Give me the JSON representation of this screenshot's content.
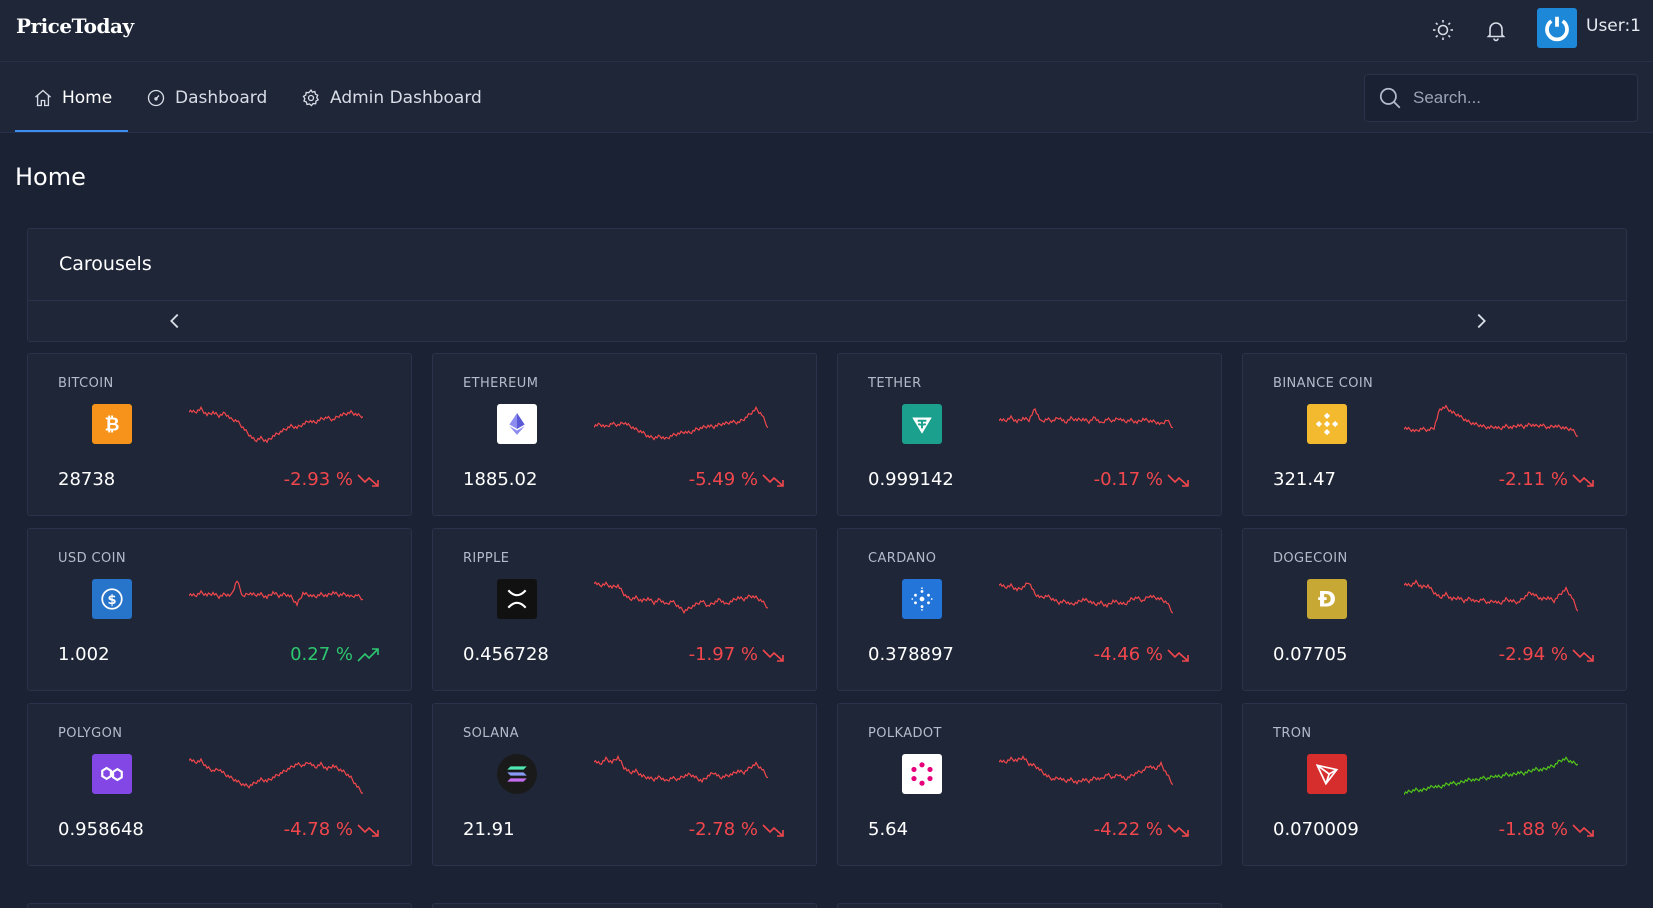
{
  "app": {
    "logo": "PriceToday"
  },
  "topbar": {
    "user_label": "User:1"
  },
  "nav": {
    "items": [
      {
        "label": "Home",
        "icon": "home-icon"
      },
      {
        "label": "Dashboard",
        "icon": "gauge-icon"
      },
      {
        "label": "Admin Dashboard",
        "icon": "gear-icon"
      }
    ],
    "search_placeholder": "Search..."
  },
  "page": {
    "title": "Home"
  },
  "carousel": {
    "title": "Carousels"
  },
  "colors": {
    "down": "#f1474c",
    "up": "#2ec770",
    "accent": "#3b8ff0"
  },
  "coins": [
    {
      "name": "BITCOIN",
      "price": "28738",
      "change": "-2.93 %",
      "direction": "down",
      "icon": "bitcoin-icon",
      "icon_bg": "#f7931a",
      "trend": [
        60,
        58,
        62,
        55,
        58,
        54,
        57,
        50,
        48,
        40,
        32,
        25,
        28,
        24,
        30,
        34,
        38,
        42,
        40,
        44,
        48,
        46,
        50,
        52,
        49,
        54,
        56,
        58,
        55,
        53
      ]
    },
    {
      "name": "ETHEREUM",
      "price": "1885.02",
      "change": "-5.49 %",
      "direction": "down",
      "icon": "ethereum-icon",
      "icon_bg": "#ffffff",
      "trend": [
        42,
        44,
        41,
        45,
        43,
        46,
        42,
        38,
        35,
        30,
        28,
        30,
        27,
        31,
        33,
        35,
        34,
        38,
        40,
        42,
        41,
        44,
        45,
        47,
        46,
        50,
        56,
        62,
        55,
        40
      ]
    },
    {
      "name": "TETHER",
      "price": "0.999142",
      "change": "-0.17 %",
      "direction": "down",
      "icon": "tether-icon",
      "icon_bg": "#1aa08c",
      "trend": [
        50,
        48,
        52,
        47,
        51,
        49,
        62,
        47,
        50,
        48,
        52,
        46,
        51,
        49,
        50,
        47,
        52,
        45,
        50,
        48,
        51,
        47,
        49,
        46,
        50,
        48,
        47,
        44,
        49,
        40
      ]
    },
    {
      "name": "BINANCE COIN",
      "price": "321.47",
      "change": "-2.11 %",
      "direction": "down",
      "icon": "binance-icon",
      "icon_bg": "#f3ba2f",
      "trend": [
        40,
        38,
        36,
        39,
        37,
        40,
        62,
        64,
        58,
        55,
        50,
        46,
        44,
        42,
        40,
        41,
        39,
        42,
        40,
        43,
        41,
        44,
        42,
        43,
        40,
        42,
        41,
        39,
        38,
        30
      ]
    },
    {
      "name": "USD COIN",
      "price": "1.002",
      "change": "0.27 %",
      "direction": "up",
      "icon": "usdc-icon",
      "icon_bg": "#2775ca",
      "trend": [
        50,
        48,
        52,
        49,
        51,
        47,
        50,
        48,
        66,
        47,
        51,
        49,
        50,
        46,
        52,
        48,
        50,
        47,
        38,
        51,
        49,
        47,
        50,
        48,
        52,
        49,
        50,
        47,
        49,
        44
      ]
    },
    {
      "name": "RIPPLE",
      "price": "0.456728",
      "change": "-1.97 %",
      "direction": "down",
      "icon": "ripple-icon",
      "icon_bg": "#111111",
      "trend": [
        64,
        60,
        62,
        58,
        60,
        50,
        44,
        46,
        42,
        45,
        40,
        44,
        38,
        42,
        36,
        30,
        34,
        38,
        42,
        36,
        40,
        44,
        38,
        42,
        46,
        44,
        48,
        46,
        42,
        34
      ]
    },
    {
      "name": "CARDANO",
      "price": "0.378897",
      "change": "-4.46 %",
      "direction": "down",
      "icon": "cardano-icon",
      "icon_bg": "#2375da",
      "trend": [
        62,
        58,
        60,
        55,
        58,
        64,
        50,
        46,
        48,
        44,
        40,
        42,
        38,
        40,
        44,
        42,
        38,
        40,
        36,
        42,
        40,
        38,
        44,
        46,
        42,
        48,
        46,
        44,
        40,
        28
      ]
    },
    {
      "name": "DOGECOIN",
      "price": "0.07705",
      "change": "-2.94 %",
      "direction": "down",
      "icon": "dogecoin-icon",
      "icon_bg": "#c8a834",
      "trend": [
        62,
        60,
        64,
        58,
        60,
        52,
        46,
        50,
        44,
        46,
        42,
        45,
        41,
        44,
        40,
        42,
        39,
        44,
        42,
        40,
        46,
        52,
        48,
        44,
        46,
        42,
        50,
        56,
        46,
        30
      ]
    },
    {
      "name": "POLYGON",
      "price": "0.958648",
      "change": "-4.78 %",
      "direction": "down",
      "icon": "polygon-icon",
      "icon_bg": "#8247e5",
      "trend": [
        62,
        58,
        60,
        52,
        48,
        50,
        44,
        40,
        36,
        32,
        30,
        34,
        38,
        36,
        40,
        44,
        48,
        52,
        56,
        54,
        58,
        52,
        56,
        50,
        54,
        50,
        46,
        40,
        30,
        22
      ]
    },
    {
      "name": "SOLANA",
      "price": "21.91",
      "change": "-2.78 %",
      "direction": "down",
      "icon": "solana-icon",
      "icon_bg": "#1a1a1a",
      "trend": [
        60,
        56,
        62,
        58,
        64,
        52,
        46,
        48,
        42,
        40,
        38,
        41,
        36,
        40,
        38,
        42,
        44,
        40,
        36,
        42,
        46,
        40,
        42,
        44,
        48,
        46,
        52,
        56,
        50,
        40
      ]
    },
    {
      "name": "POLKADOT",
      "price": "5.64",
      "change": "-4.22 %",
      "direction": "down",
      "icon": "polkadot-icon",
      "icon_bg": "#ffffff",
      "trend": [
        60,
        58,
        62,
        60,
        64,
        56,
        54,
        48,
        42,
        38,
        40,
        36,
        38,
        34,
        38,
        36,
        40,
        38,
        44,
        40,
        44,
        38,
        42,
        46,
        48,
        54,
        50,
        56,
        44,
        32
      ]
    },
    {
      "name": "TRON",
      "price": "0.070009",
      "change": "-1.88 %",
      "direction": "down",
      "icon": "tron-icon",
      "icon_bg": "#d62d2d",
      "trend": [
        22,
        24,
        26,
        25,
        28,
        30,
        29,
        32,
        34,
        33,
        36,
        38,
        37,
        40,
        39,
        42,
        41,
        44,
        43,
        46,
        45,
        48,
        50,
        49,
        52,
        54,
        60,
        62,
        58,
        56
      ],
      "trend_color": "#52c41a"
    }
  ]
}
